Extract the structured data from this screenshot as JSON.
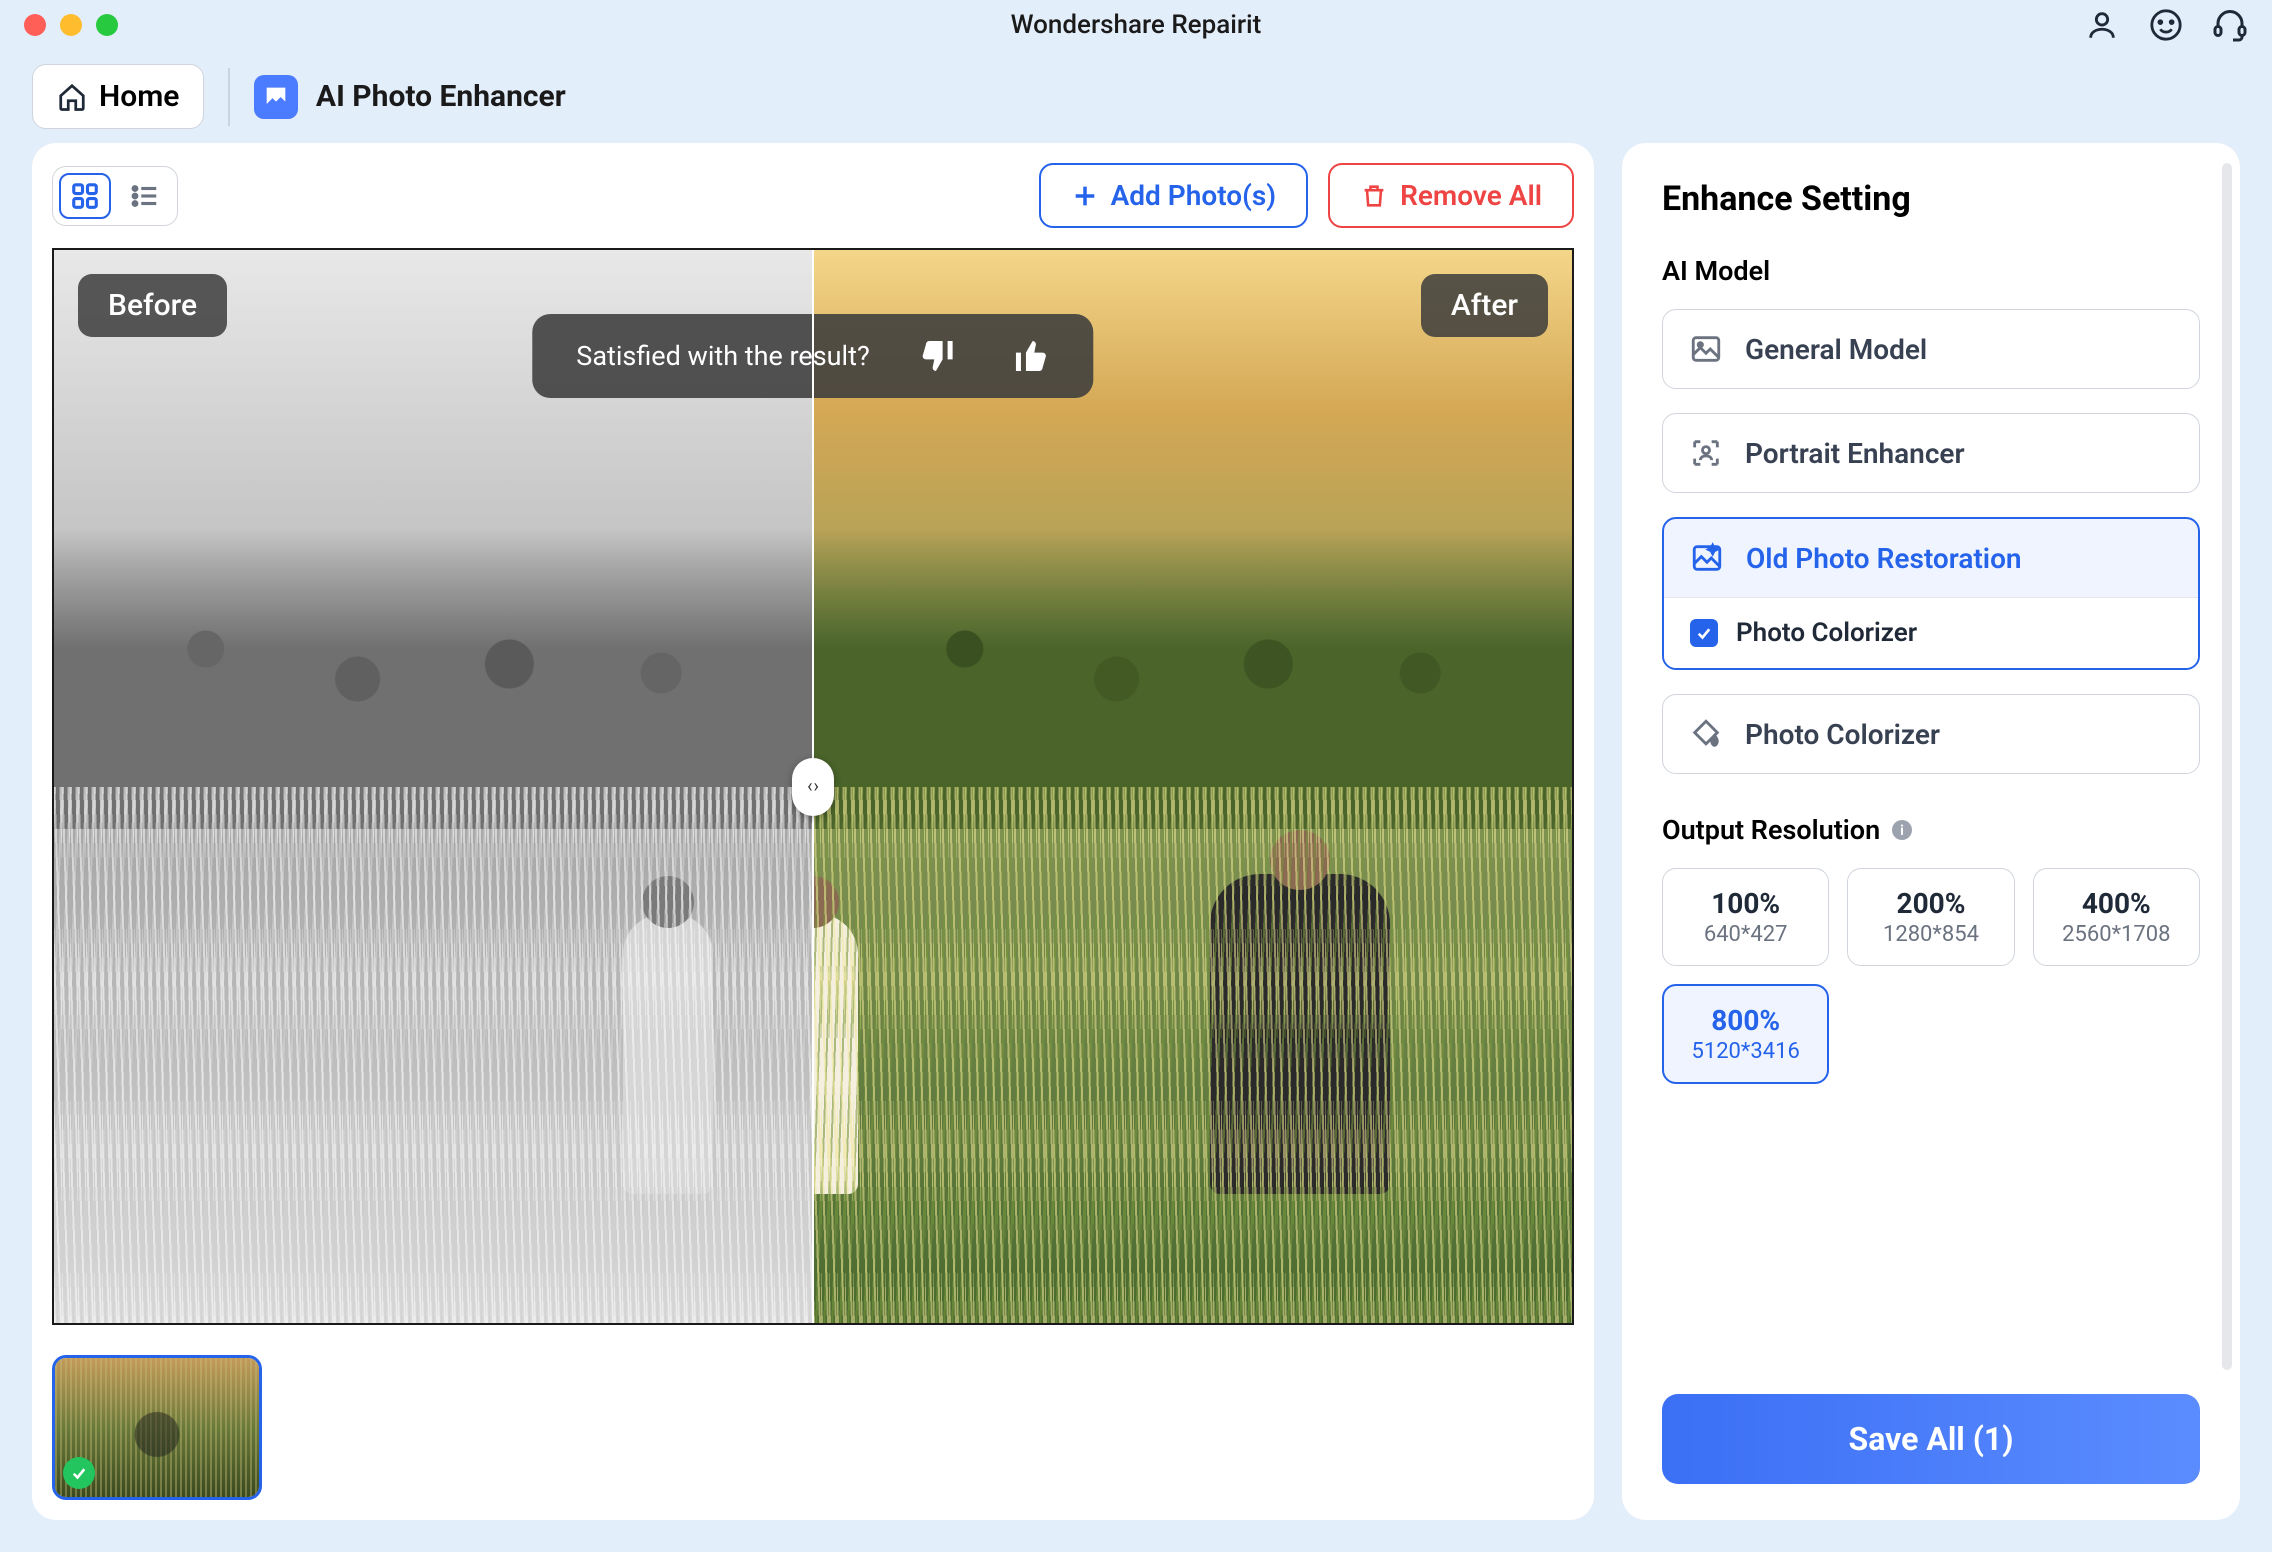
{
  "app": {
    "title": "Wondershare Repairit"
  },
  "breadcrumb": {
    "home_label": "Home",
    "section_label": "AI Photo Enhancer"
  },
  "toolbar": {
    "add_label": "Add Photo(s)",
    "remove_label": "Remove All"
  },
  "preview": {
    "before_label": "Before",
    "after_label": "After",
    "feedback_prompt": "Satisfied with the result?"
  },
  "panel": {
    "title": "Enhance Setting",
    "ai_model_label": "AI Model",
    "models": {
      "general": "General Model",
      "portrait": "Portrait Enhancer",
      "old_photo": "Old Photo Restoration",
      "old_photo_sub": "Photo Colorizer",
      "colorizer": "Photo Colorizer"
    },
    "output_label": "Output Resolution",
    "resolutions": [
      {
        "pct": "100%",
        "dim": "640*427"
      },
      {
        "pct": "200%",
        "dim": "1280*854"
      },
      {
        "pct": "400%",
        "dim": "2560*1708"
      },
      {
        "pct": "800%",
        "dim": "5120*3416"
      }
    ],
    "save_label": "Save All (1)"
  }
}
